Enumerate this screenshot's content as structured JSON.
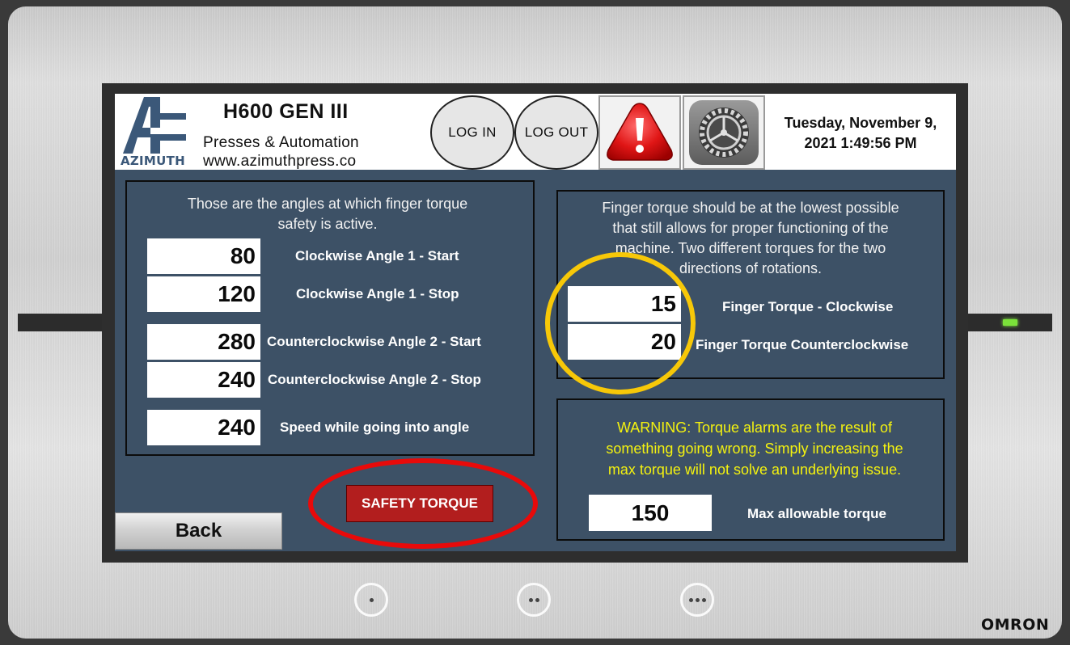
{
  "header": {
    "logo_text": "AZIMUTH",
    "title": "H600 GEN III",
    "subtitle": "Presses & Automation",
    "url": "www.azimuthpress.co",
    "login_label": "LOG IN",
    "logout_label": "LOG OUT",
    "alarm_icon": "warning-icon",
    "settings_icon": "gear-icon",
    "datetime_line1": "Tuesday, November 9,",
    "datetime_line2": "2021 1:49:56 PM"
  },
  "angles_panel": {
    "description_line1": "Those are the angles at which finger torque",
    "description_line2": "safety is active.",
    "rows": [
      {
        "value": "80",
        "label": "Clockwise Angle 1 - Start"
      },
      {
        "value": "120",
        "label": "Clockwise Angle 1 - Stop"
      },
      {
        "value": "280",
        "label": "Counterclockwise Angle 2 - Start"
      },
      {
        "value": "240",
        "label": "Counterclockwise Angle 2 - Stop"
      },
      {
        "value": "240",
        "label": "Speed while going into angle"
      }
    ]
  },
  "finger_panel": {
    "description_line1": "Finger torque should be at the lowest possible",
    "description_line2": "that still allows for proper functioning of the",
    "description_line3": "machine. Two different torques for the two",
    "description_line4": "directions of rotations.",
    "rows": [
      {
        "value": "15",
        "label": "Finger Torque - Clockwise"
      },
      {
        "value": "20",
        "label": "Finger Torque Counterclockwise"
      }
    ]
  },
  "max_panel": {
    "warning_line1": "WARNING: Torque alarms are the result of",
    "warning_line2": "something going wrong. Simply increasing the",
    "warning_line3": "max torque will not solve an underlying issue.",
    "value": "150",
    "label": "Max allowable torque"
  },
  "buttons": {
    "safety_torque": "SAFETY TORQUE",
    "back": "Back"
  },
  "device": {
    "brand": "OMRON"
  },
  "colors": {
    "screen_bg": "#3d5166",
    "warning_text": "#f4f20f",
    "safety_button": "#b21e1e",
    "highlight_yellow": "#f7c808",
    "highlight_red": "#e80a0a",
    "status_led": "#7be23a"
  }
}
